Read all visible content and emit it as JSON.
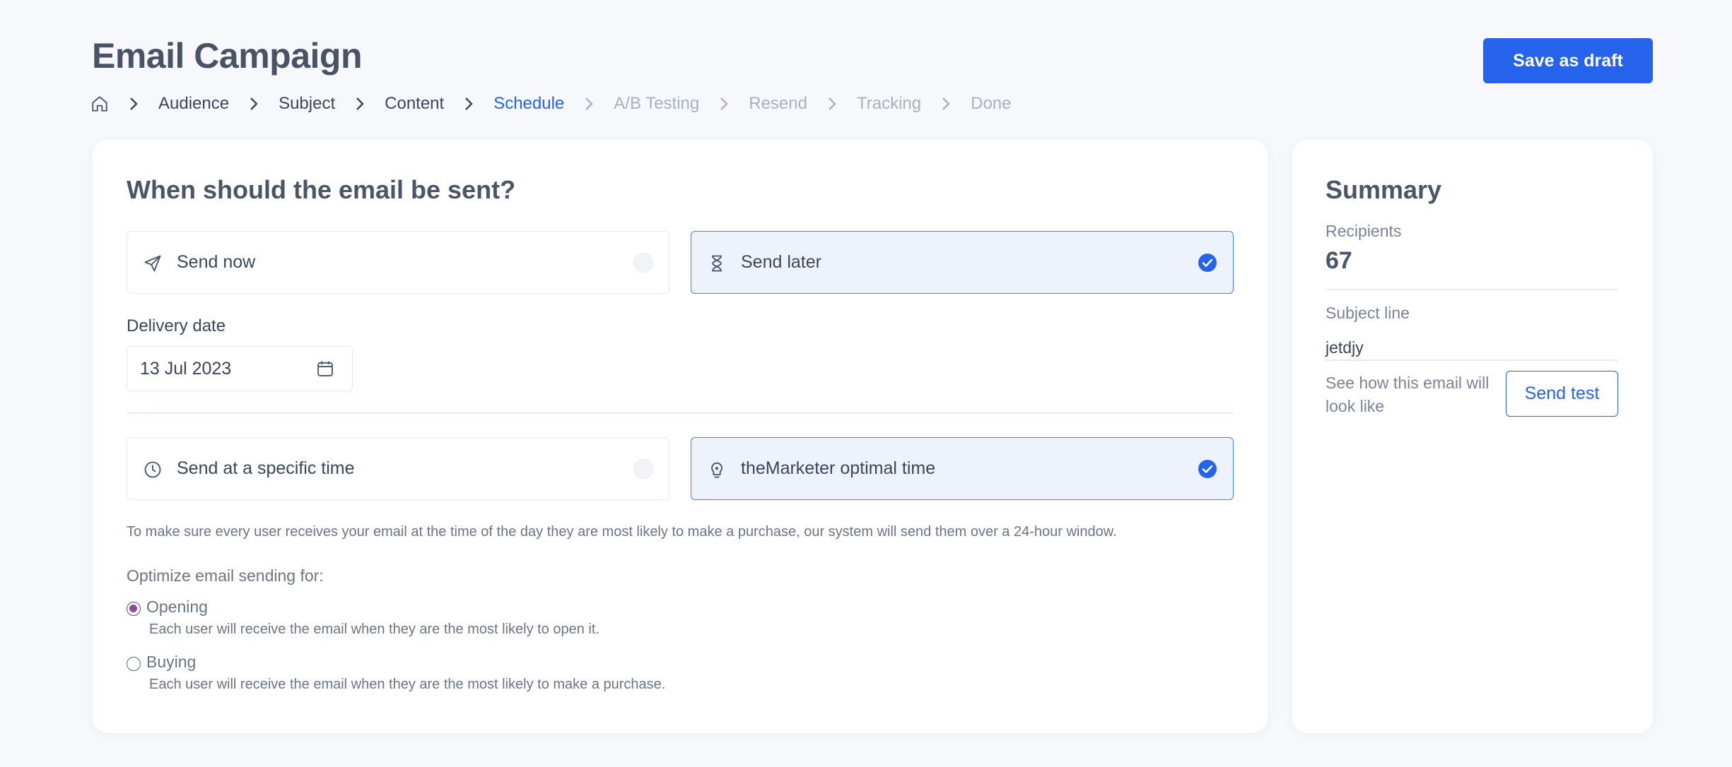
{
  "header": {
    "title": "Email Campaign",
    "save_draft_label": "Save as draft"
  },
  "breadcrumb": {
    "home_icon": "home-icon",
    "steps": [
      {
        "label": "Audience",
        "state": "done"
      },
      {
        "label": "Subject",
        "state": "done"
      },
      {
        "label": "Content",
        "state": "done"
      },
      {
        "label": "Schedule",
        "state": "active"
      },
      {
        "label": "A/B Testing",
        "state": "future"
      },
      {
        "label": "Resend",
        "state": "future"
      },
      {
        "label": "Tracking",
        "state": "future"
      },
      {
        "label": "Done",
        "state": "future"
      }
    ]
  },
  "schedule": {
    "title": "When should the email be sent?",
    "send_options": [
      {
        "label": "Send now",
        "icon": "send-icon",
        "selected": false
      },
      {
        "label": "Send later",
        "icon": "hourglass-icon",
        "selected": true
      }
    ],
    "delivery_date_label": "Delivery date",
    "delivery_date_value": "13 Jul 2023",
    "time_options": [
      {
        "label": "Send at a specific time",
        "icon": "clock-icon",
        "selected": false
      },
      {
        "label": "theMarketer optimal time",
        "icon": "brain-icon",
        "selected": true
      }
    ],
    "help_text": "To make sure every user receives your email at the time of the day they are most likely to make a purchase, our system will send them over a 24-hour window.",
    "optimize_heading": "Optimize email sending for:",
    "optimize_options": [
      {
        "label": "Opening",
        "description": "Each user will receive the email when they are the most likely to open it.",
        "checked": true
      },
      {
        "label": "Buying",
        "description": "Each user will receive the email when they are the most likely to make a purchase.",
        "checked": false
      }
    ]
  },
  "summary": {
    "title": "Summary",
    "recipients_label": "Recipients",
    "recipients_value": "67",
    "subject_label": "Subject line",
    "subject_value": "jetdjy",
    "preview_text": "See how this email will look like",
    "send_test_label": "Send test"
  },
  "colors": {
    "accent": "#2563eb",
    "radio_checked": "#8c4a98",
    "page_bg": "#f6f8fb"
  }
}
